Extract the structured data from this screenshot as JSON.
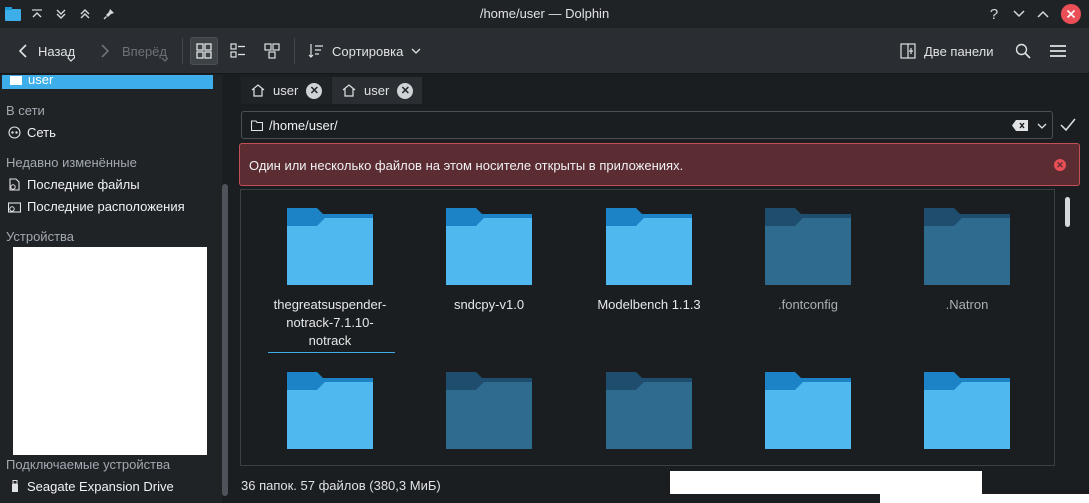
{
  "window": {
    "title": "/home/user — Dolphin",
    "controls": [
      "help-icon",
      "minimize-icon",
      "maximize-icon",
      "close-icon"
    ]
  },
  "toolbar": {
    "back_label": "Назад",
    "forward_label": "Вперёд",
    "sort_label": "Сортировка",
    "split_label": "Две панели"
  },
  "sidebar": {
    "selected_label": "user",
    "network_header": "В сети",
    "network_item": "Сеть",
    "recent_header": "Недавно изменённые",
    "recent_files": "Последние файлы",
    "recent_locations": "Последние расположения",
    "devices_header": "Устройства",
    "removable_header": "Подключаемые устройства",
    "removable_item": "Seagate Expansion Drive"
  },
  "tabs": [
    {
      "label": "user",
      "active": true
    },
    {
      "label": "user",
      "active": false
    }
  ],
  "location": {
    "path": "/home/user/"
  },
  "banner": {
    "message": "Один или несколько файлов на этом носителе открыты в приложениях."
  },
  "files": [
    {
      "name": "thegreatsuspender-notrack-7.1.10-notrack",
      "lines": [
        "thegreatsuspender-",
        "notrack-7.1.10-",
        "notrack"
      ],
      "hidden": false
    },
    {
      "name": "sndcpy-v1.0",
      "lines": [
        "sndcpy-v1.0"
      ],
      "hidden": false
    },
    {
      "name": "Modelbench 1.1.3",
      "lines": [
        "Modelbench 1.1.3"
      ],
      "hidden": false
    },
    {
      "name": ".fontconfig",
      "lines": [
        ".fontconfig"
      ],
      "hidden": true
    },
    {
      "name": ".Natron",
      "lines": [
        ".Natron"
      ],
      "hidden": true
    },
    {
      "name": "",
      "lines": [],
      "hidden": false
    },
    {
      "name": "",
      "lines": [],
      "hidden": true
    },
    {
      "name": "",
      "lines": [],
      "hidden": true
    },
    {
      "name": "",
      "lines": [],
      "hidden": false
    },
    {
      "name": "",
      "lines": [],
      "hidden": false
    }
  ],
  "status": {
    "summary": "36 папок. 57 файлов (380,3 МиБ)"
  },
  "colors": {
    "accent": "#3daee9",
    "folder_front": "#4fb8ee",
    "folder_back": "#1c84c6",
    "hidden_folder_front": "#2f6b8f",
    "hidden_folder_back": "#1f4d6d",
    "banner_bg": "#5b2d32",
    "banner_border": "#c24f58"
  }
}
